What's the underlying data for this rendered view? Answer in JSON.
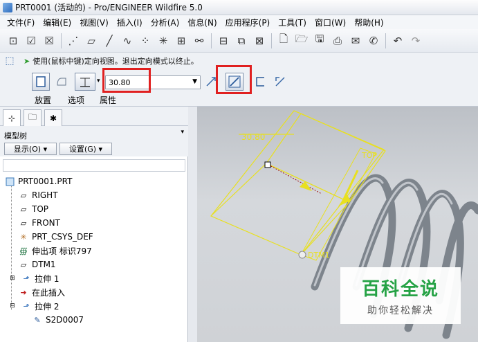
{
  "window": {
    "title": "PRT0001 (活动的) - Pro/ENGINEER Wildfire 5.0"
  },
  "menubar": {
    "items": [
      "文件(F)",
      "编辑(E)",
      "视图(V)",
      "插入(I)",
      "分析(A)",
      "信息(N)",
      "应用程序(P)",
      "工具(T)",
      "窗口(W)",
      "帮助(H)"
    ]
  },
  "toolbar": {
    "icons": [
      "new-sketch-icon",
      "checkbox-icon",
      "close-box-icon",
      "datum-axis-icon",
      "datum-plane-icon",
      "datum-curve-icon",
      "spline-icon",
      "point-icon",
      "csys-icon",
      "analysis-icon",
      "link-icon",
      "window-icon",
      "layer-icon",
      "print-setup-icon",
      "new-file-icon",
      "open-icon",
      "save-icon",
      "print-icon",
      "send-icon",
      "mail-icon",
      "undo-icon",
      "redo-icon"
    ]
  },
  "dashboard": {
    "prompt": "使用(鼠标中键)定向视图。退出定向模式以终止。",
    "depth_value": "30.80",
    "tabs": [
      "放置",
      "选项",
      "属性"
    ]
  },
  "model_tree": {
    "header_label": "模型树",
    "show_button": "显示(O) ▾",
    "settings_button": "设置(G) ▾",
    "items": [
      {
        "label": "PRT0001.PRT",
        "icon": "part-icon"
      },
      {
        "label": "RIGHT",
        "icon": "datum-plane-icon"
      },
      {
        "label": "TOP",
        "icon": "datum-plane-icon"
      },
      {
        "label": "FRONT",
        "icon": "datum-plane-icon"
      },
      {
        "label": "PRT_CSYS_DEF",
        "icon": "csys-icon"
      },
      {
        "label": "伸出项 标识797",
        "icon": "protrusion-icon"
      },
      {
        "label": "DTM1",
        "icon": "datum-plane-icon"
      },
      {
        "label": "拉伸 1",
        "icon": "extrude-icon"
      },
      {
        "label": "在此插入",
        "icon": "insert-here-icon"
      },
      {
        "label": "拉伸 2",
        "icon": "extrude-icon"
      },
      {
        "label": "S2D0007",
        "icon": "sketch-icon"
      }
    ]
  },
  "graphics": {
    "dim_label": "30.80",
    "top_label": "TOP",
    "dtm_label": "DTM1"
  },
  "watermark": {
    "main": "百科全说",
    "sub": "助你轻松解决"
  },
  "colors": {
    "highlight_red": "#e02020",
    "preview_yellow": "#e8e020",
    "watermark_green": "#25a245"
  }
}
